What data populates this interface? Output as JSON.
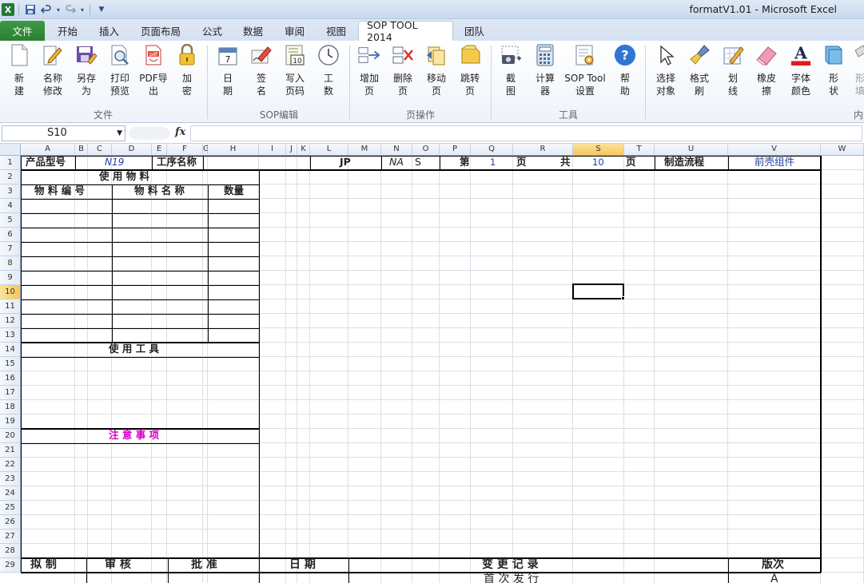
{
  "window": {
    "title": "formatV1.01  -  Microsoft Excel",
    "app_icon": "X"
  },
  "quick_access": [
    "save-icon",
    "undo-icon",
    "redo-icon",
    "customize-icon"
  ],
  "tabs": [
    {
      "label": "文件"
    },
    {
      "label": "开始"
    },
    {
      "label": "插入"
    },
    {
      "label": "页面布局"
    },
    {
      "label": "公式"
    },
    {
      "label": "数据"
    },
    {
      "label": "审阅"
    },
    {
      "label": "视图"
    },
    {
      "label": "SOP TOOL 2014"
    },
    {
      "label": "团队"
    }
  ],
  "ribbon": {
    "groups": {
      "file": "文件",
      "sop_edit": "SOP编辑",
      "page_ops": "页操作",
      "tools": "工具",
      "built_in": "内置"
    },
    "buttons": {
      "new": "新\n建",
      "rename": "名称\n修改",
      "saveas": "另存\n为",
      "preview": "打印\n预览",
      "pdf": "PDF导\n出",
      "encrypt": "加\n密",
      "date": "日\n期",
      "sign": "签\n名",
      "pagecode": "写入\n页码",
      "worktime": "工\n数",
      "addpage": "增加\n页",
      "delpage": "删除\n页",
      "movepage": "移动\n页",
      "jumppage": "跳转\n页",
      "screenshot": "截\n图",
      "calc": "计算\n器",
      "settings": "SOP Tool\n设置",
      "help": "帮\n助",
      "select": "选择\n对象",
      "painter": "格式\n刷",
      "drawline": "划\n线",
      "eraser": "橡皮\n擦",
      "fontcolor": "字体\n颜色",
      "shape": "形\n状",
      "fill": "形\n填"
    }
  },
  "formula_bar": {
    "name_box": "S10",
    "fx": "fx",
    "formula": ""
  },
  "columns": [
    "A",
    "B",
    "C",
    "D",
    "E",
    "F",
    "G",
    "H",
    "I",
    "J",
    "K",
    "L",
    "M",
    "N",
    "O",
    "P",
    "Q",
    "R",
    "S",
    "T",
    "U",
    "V",
    "W"
  ],
  "rows": [
    "1",
    "2",
    "3",
    "4",
    "5",
    "6",
    "7",
    "8",
    "9",
    "10",
    "11",
    "12",
    "13",
    "14",
    "15",
    "16",
    "17",
    "18",
    "19",
    "20",
    "21",
    "22",
    "23",
    "24",
    "25",
    "26",
    "27",
    "28",
    "29"
  ],
  "sheet": {
    "product_label": "产品型号",
    "product_value": "N19",
    "process_label": "工序名称",
    "jp": "JP",
    "na": "NA",
    "s": "S",
    "di": "第",
    "page_no": "1",
    "ye1": "页",
    "gong": "共",
    "total": "10",
    "ye2": "页",
    "flow_label": "制造流程",
    "flow_value": "前壳组件",
    "materials_title": "使   用   物   料",
    "mat_code": "物 料 编 号",
    "mat_name": "物 料 名 称",
    "qty": "数量",
    "tools_title": "使 用 工 具",
    "notes_title": "注 意 事 项",
    "draft": "拟    制",
    "review": "审    核",
    "approve": "批    准",
    "date": "日 期",
    "change_record": "变     更     记     录",
    "version": "版次",
    "first_issue": "首     次     发     行",
    "version_value": "A"
  }
}
